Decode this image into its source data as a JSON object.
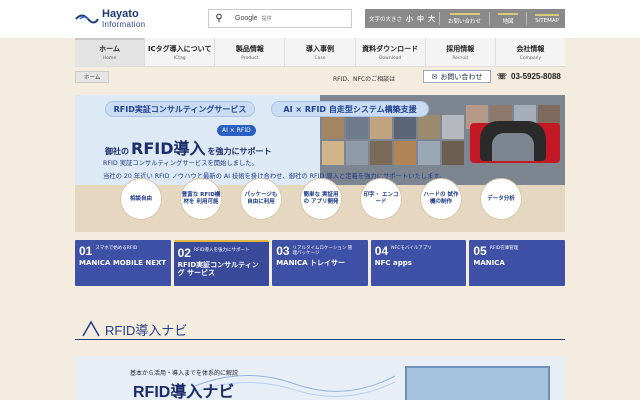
{
  "header": {
    "logo_line1": "Hayato",
    "logo_line2": "Information",
    "search_brand": "Google",
    "search_tag": "提供",
    "font_size_label": "文字の大きさ",
    "font_small": "小",
    "font_medium": "中",
    "font_large": "大",
    "links": [
      "お問い合わせ",
      "地図",
      "SITEMAP"
    ]
  },
  "nav": [
    {
      "jp": "ホーム",
      "en": "Home"
    },
    {
      "jp": "ICタグ導入について",
      "en": "ICtag"
    },
    {
      "jp": "製品情報",
      "en": "Product"
    },
    {
      "jp": "導入事例",
      "en": "Case"
    },
    {
      "jp": "資料ダウンロード",
      "en": "Download"
    },
    {
      "jp": "採用情報",
      "en": "Recruit"
    },
    {
      "jp": "会社情報",
      "en": "Company"
    }
  ],
  "breadcrumb": {
    "home": "ホーム",
    "note": "RFID、NFCのご相談は",
    "inquiry": "お問い合わせ",
    "phone": "03-5925-8088"
  },
  "hero": {
    "pill_left": "RFID実証コンサルティングサービス",
    "pill_right": "AI × RFID 自走型システム構築支援",
    "ai_tag": "AI × RFID",
    "title_pre": "御社の",
    "title_big": "RFID導入",
    "title_post": "を強力にサポート",
    "desc1": "RFID 実証コンサルティングサービスを開始しました。",
    "desc2": "当社の 20 年近い RFID ノウハウと最新の AI 技術を掛け合わせ、御社の RFID 導入と定着を強力にサポートいたします。",
    "circles": [
      "相談自由",
      "豊富な RFID機材を 利用可能",
      "パッケージも 自由に利用",
      "簡単な 実証用の アプリ開発",
      "印字・ エンコード",
      "ハードの 試作機の制作",
      "データ分析"
    ]
  },
  "cards": [
    {
      "num": "01",
      "small": "スマホで始めるRFID",
      "title": "MANICA MOBILE NEXT"
    },
    {
      "num": "02",
      "small": "RFID導入を強力にサポート",
      "title": "RFID実証コンサルティング サービス"
    },
    {
      "num": "03",
      "small": "リアルタイムロケーション 管理パッケージ",
      "title": "MANICA トレイサー"
    },
    {
      "num": "04",
      "small": "NFCモバイルアプリ",
      "title": "NFC apps"
    },
    {
      "num": "05",
      "small": "RFID在庫管理",
      "title": "MANICA"
    }
  ],
  "section": {
    "title": "RFID導入ナビ"
  },
  "banner": {
    "sub": "基本から活用・導入までを体系的に解説",
    "title": "RFID導入ナビ"
  },
  "colors": {
    "brand": "#233e8b",
    "card": "#3f51a6",
    "accent": "#e6b640"
  }
}
